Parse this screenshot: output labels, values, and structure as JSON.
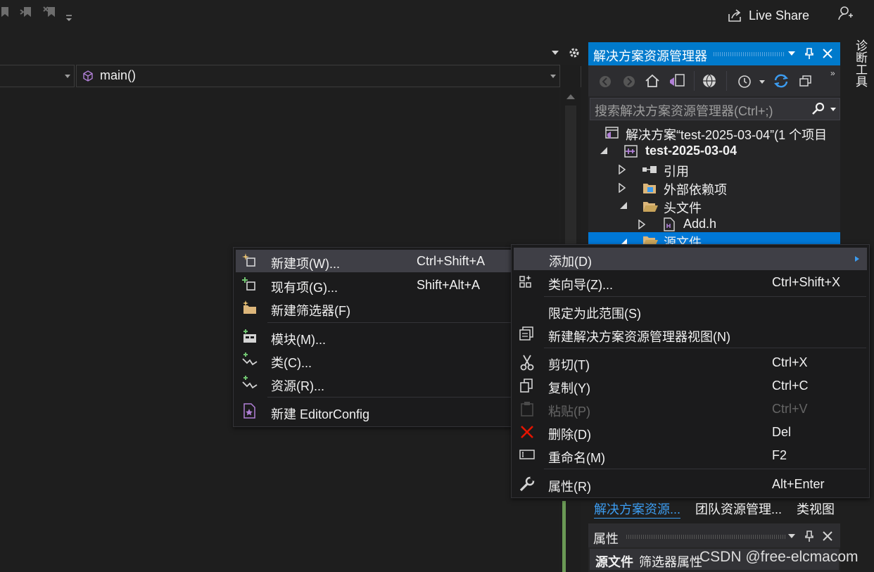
{
  "topbar": {
    "live_share": "Live Share"
  },
  "navbar": {
    "function_combo": "main()"
  },
  "solution_explorer": {
    "title": "解决方案资源管理器",
    "search_placeholder": "搜索解决方案资源管理器(Ctrl+;)",
    "tree": {
      "solution": "解决方案“test-2025-03-04”(1 个项目",
      "project": "test-2025-03-04",
      "references": "引用",
      "external_deps": "外部依赖项",
      "header_files": "头文件",
      "add_h": "Add.h",
      "source_files": "源文件"
    },
    "tabs": [
      "解决方案资源...",
      "团队资源管理...",
      "类视图"
    ]
  },
  "right_rail": {
    "diagnostic_tools": "诊断工具"
  },
  "properties": {
    "title": "属性",
    "object_name": "源文件",
    "object_type": "筛选器属性"
  },
  "context_menu": {
    "add": "添加(D)",
    "class_wizard": {
      "label": "类向导(Z)...",
      "shortcut": "Ctrl+Shift+X"
    },
    "scope": "限定为此范围(S)",
    "new_view": "新建解决方案资源管理器视图(N)",
    "cut": {
      "label": "剪切(T)",
      "shortcut": "Ctrl+X"
    },
    "copy": {
      "label": "复制(Y)",
      "shortcut": "Ctrl+C"
    },
    "paste": {
      "label": "粘贴(P)",
      "shortcut": "Ctrl+V"
    },
    "delete": {
      "label": "删除(D)",
      "shortcut": "Del"
    },
    "rename": {
      "label": "重命名(M)",
      "shortcut": "F2"
    },
    "properties": {
      "label": "属性(R)",
      "shortcut": "Alt+Enter"
    }
  },
  "submenu": {
    "new_item": {
      "label": "新建项(W)...",
      "shortcut": "Ctrl+Shift+A"
    },
    "existing_item": {
      "label": "现有项(G)...",
      "shortcut": "Shift+Alt+A"
    },
    "new_filter": "新建筛选器(F)",
    "module": "模块(M)...",
    "class": "类(C)...",
    "resource": "资源(R)...",
    "editorconfig": "新建 EditorConfig"
  },
  "watermark": "CSDN @free-elcmacom",
  "colors": {
    "accent": "#007acc",
    "selected": "#3f3f46",
    "delete_red": "#e51400",
    "project_purple": "#b180d7",
    "folder_yellow": "#dcb67a"
  }
}
